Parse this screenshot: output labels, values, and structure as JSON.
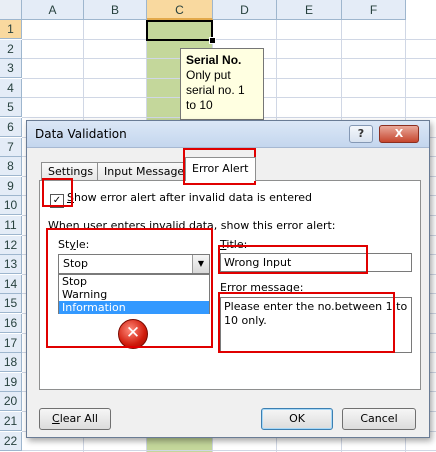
{
  "sheet": {
    "columns": [
      "A",
      "B",
      "C",
      "D",
      "E",
      "F"
    ],
    "active_column": "C",
    "rows": [
      "1",
      "2",
      "3",
      "4",
      "5",
      "6",
      "7",
      "8",
      "9",
      "10",
      "11",
      "12",
      "13",
      "14",
      "15",
      "16",
      "17",
      "18",
      "19",
      "20",
      "21",
      "22"
    ],
    "active_row": "1",
    "input_tooltip": {
      "title": "Serial No.",
      "message": "Only put serial no. 1 to 10"
    }
  },
  "dialog": {
    "title": "Data Validation",
    "titlebar_buttons": {
      "help": "?",
      "close": "X"
    },
    "tabs": [
      "Settings",
      "Input Message",
      "Error Alert"
    ],
    "selected_tab": "Error Alert",
    "show_alert_checkbox": {
      "checked": true,
      "check_mark": "✓",
      "label_prefix": "S",
      "label_rest": "how error alert after invalid data is entered"
    },
    "section_label": "When user enters invalid data, show this error alert:",
    "style_label_prefix": "St",
    "style_label_access": "y",
    "style_label_suffix": "le:",
    "style_value": "Stop",
    "style_options": [
      "Stop",
      "Warning",
      "Information"
    ],
    "highlighted_option": "Information",
    "error_icon": "error-x-icon",
    "error_icon_glyph": "✕",
    "title_label_access": "T",
    "title_label_rest": "itle:",
    "title_value": "Wrong Input",
    "error_message_label_access": "E",
    "error_message_label_rest": "rror message:",
    "error_message_value": "Please enter the no.between 1 to 10 only.",
    "buttons": {
      "clear_all_access": "C",
      "clear_all_rest": "lear All",
      "ok": "OK",
      "cancel": "Cancel"
    },
    "highlight_color": "#e00000"
  }
}
